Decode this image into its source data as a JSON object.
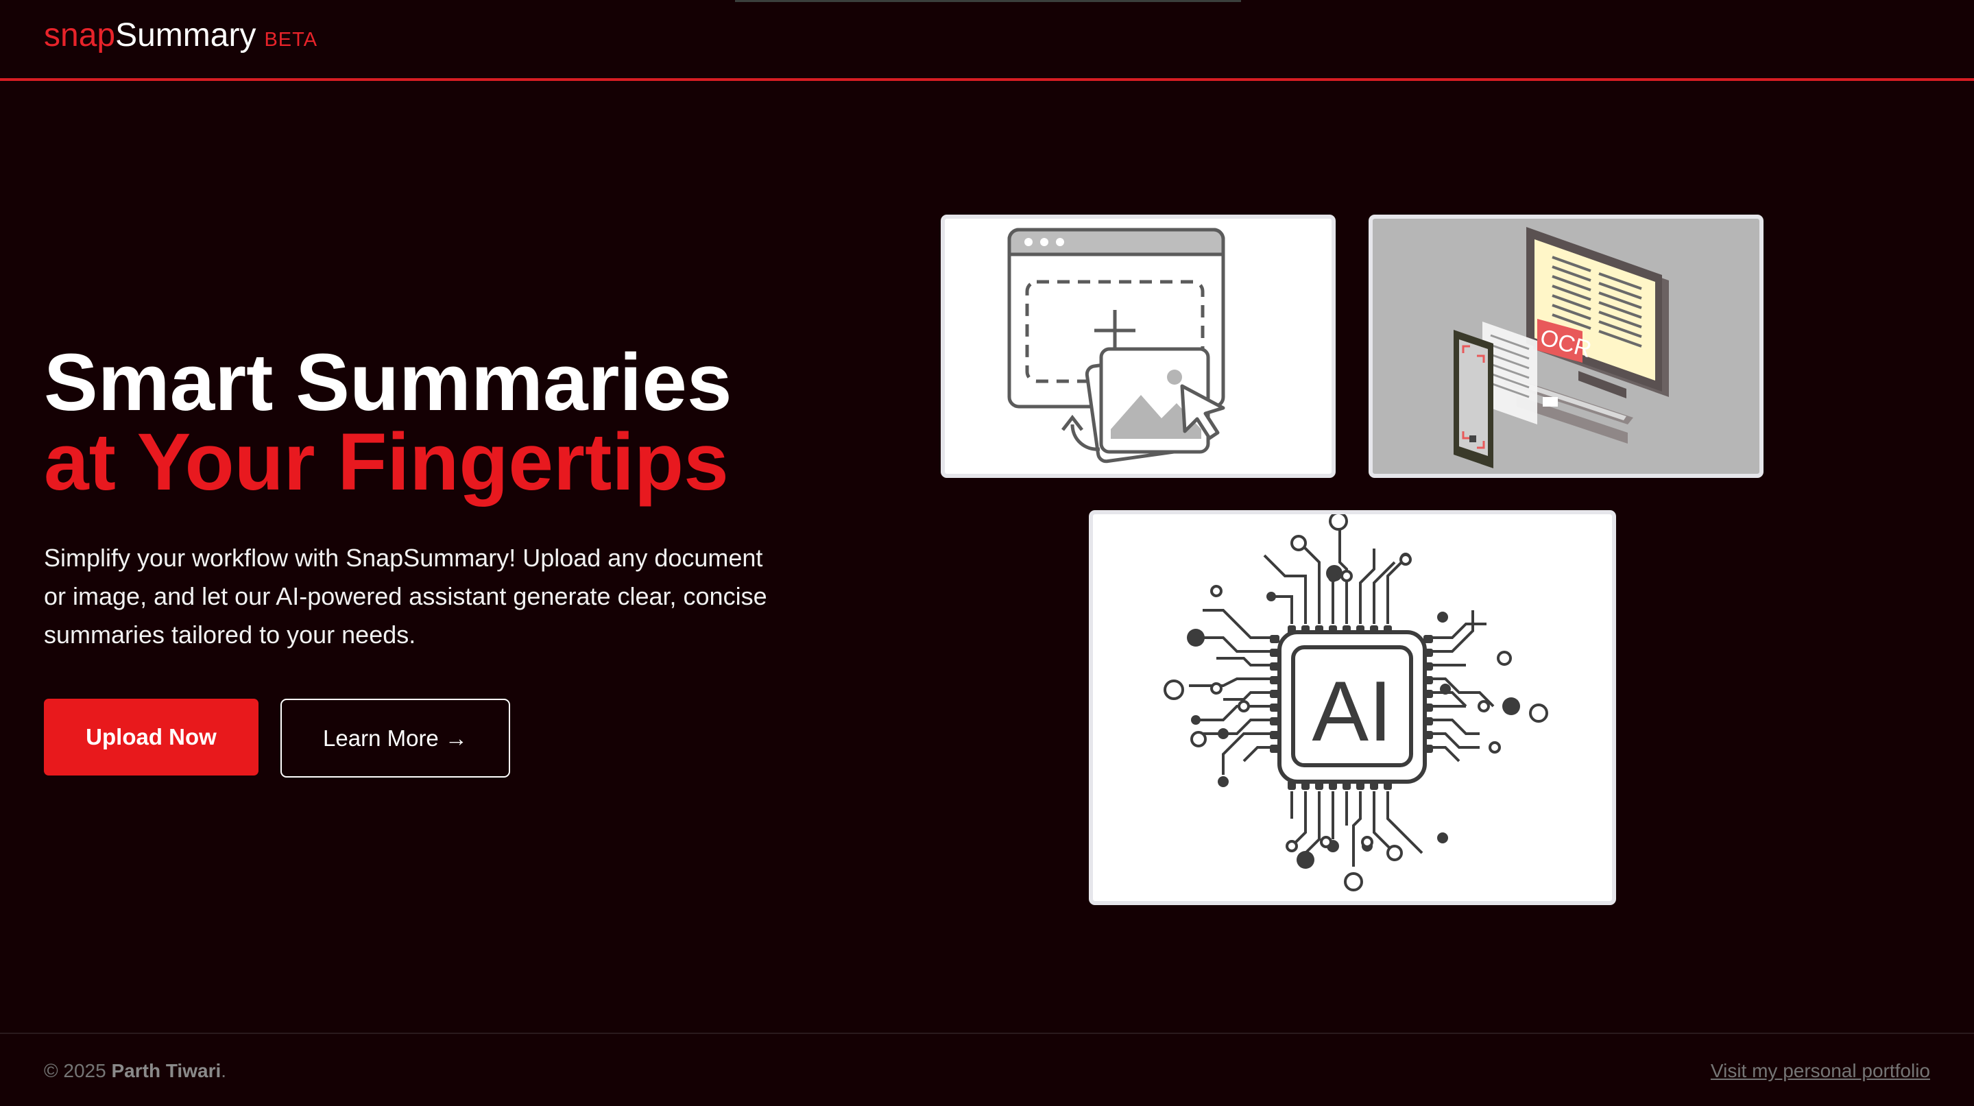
{
  "brand": {
    "logo_part1": "snap",
    "logo_part2": "Summary",
    "badge": "BETA"
  },
  "hero": {
    "title_line1": "Smart Summaries",
    "title_line2": "at Your Fingertips",
    "description": "Simplify your workflow with SnapSummary! Upload any document or image, and let our AI-powered assistant generate clear, concise summaries tailored to your needs.",
    "primary_button": "Upload Now",
    "secondary_button": "Learn More →"
  },
  "illustrations": {
    "ocr_label": "OCR",
    "ai_label": "AI",
    "icons": [
      "upload-image-icon",
      "ocr-scan-icon",
      "ai-chip-icon"
    ]
  },
  "footer": {
    "copyright_prefix": "© 2025",
    "author": "Parth Tiwari",
    "copyright_suffix": ".",
    "portfolio_link": "Visit my personal portfolio"
  },
  "colors": {
    "background": "#140003",
    "accent": "#e8191f",
    "text": "#ffffff",
    "muted": "#757575"
  }
}
